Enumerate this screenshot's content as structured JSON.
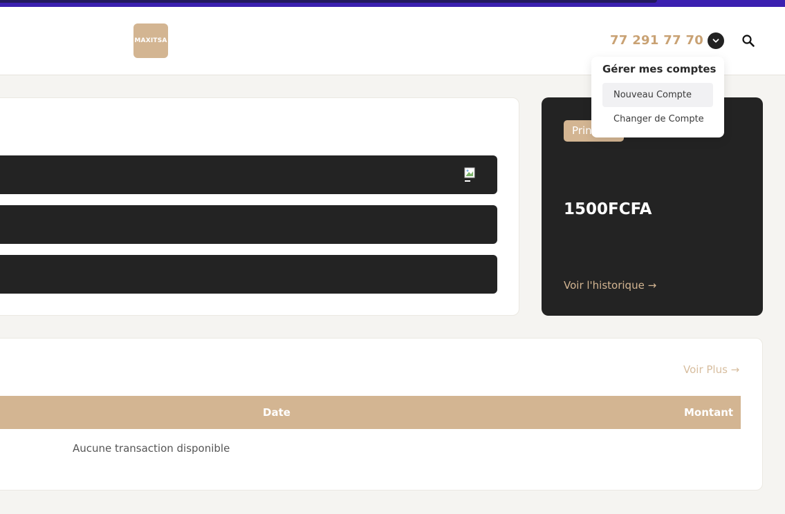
{
  "header": {
    "logo_text": "MAXITSA",
    "phone": "77 291 77 70",
    "account_toggle_icon": "chevron-down-icon",
    "search_icon": "search-icon"
  },
  "account_menu": {
    "title": "Gérer mes comptes",
    "items": [
      {
        "label": "Nouveau Compte",
        "active": true
      },
      {
        "label": "Changer de Compte",
        "active": false
      }
    ]
  },
  "balance_card": {
    "badge": "Principal",
    "amount": "1500FCFA",
    "history_link": "Voir l'historique →"
  },
  "transactions": {
    "see_more": "Voir Plus →",
    "columns": [
      "Date",
      "Montant"
    ],
    "empty_message": "Aucune transaction disponible"
  },
  "colors": {
    "accent": "#d3b592",
    "phone": "#c9a274",
    "dark": "#232323",
    "top_bar": "#3b20b0"
  }
}
